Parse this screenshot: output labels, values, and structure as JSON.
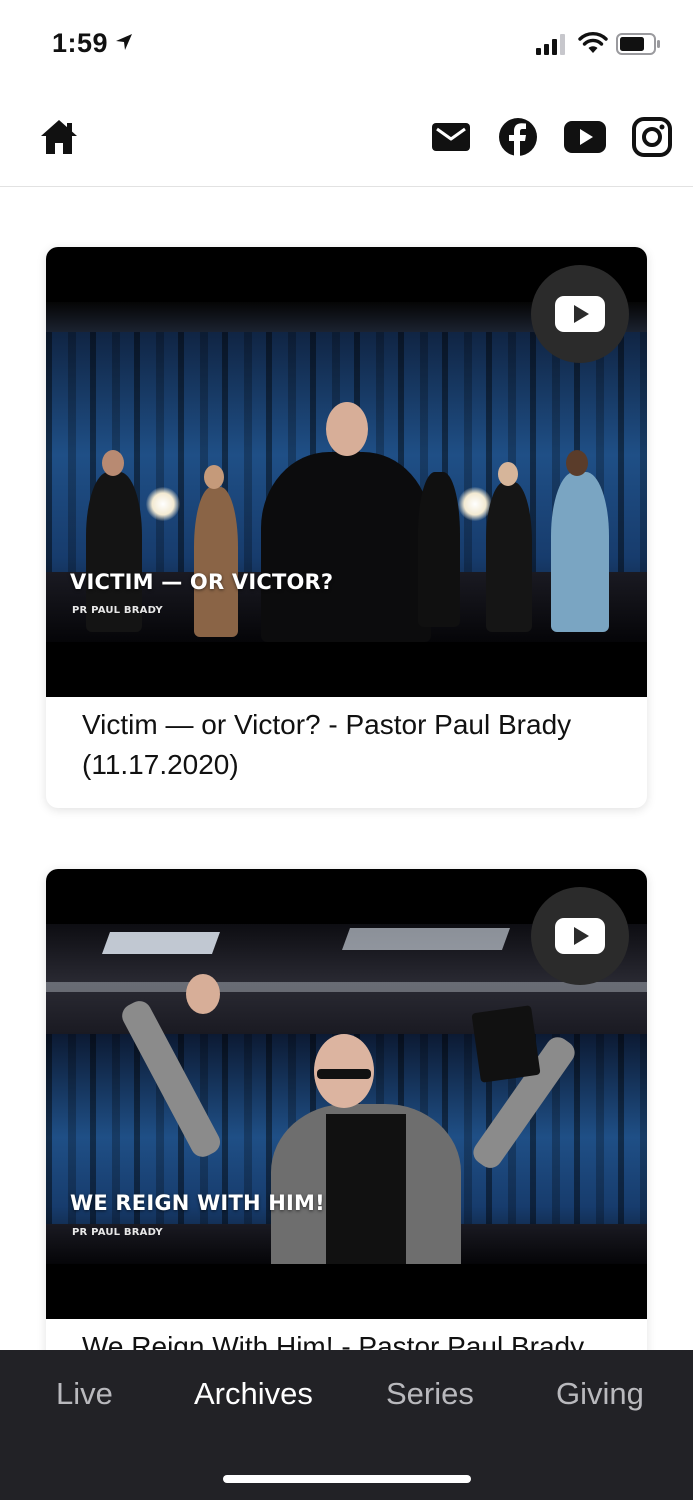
{
  "status_bar": {
    "time": "1:59",
    "icons": [
      "location-arrow-icon",
      "cellular-signal-icon",
      "wifi-icon",
      "battery-icon"
    ]
  },
  "header": {
    "icons": [
      "home-icon",
      "mail-icon",
      "facebook-icon",
      "youtube-icon",
      "instagram-icon"
    ]
  },
  "videos": [
    {
      "overlay_title": "VICTIM — OR VICTOR?",
      "overlay_subtitle": "PR PAUL BRADY",
      "title": "Victim — or Victor? - Pastor Paul Brady (11.17.2020)"
    },
    {
      "overlay_title": "WE REIGN WITH HIM!",
      "overlay_subtitle": "PR PAUL BRADY",
      "title": "We Reign With Him! - Pastor Paul Brady"
    }
  ],
  "tabs": [
    {
      "label": "Live",
      "active": false
    },
    {
      "label": "Archives",
      "active": true
    },
    {
      "label": "Series",
      "active": false
    },
    {
      "label": "Giving",
      "active": false
    }
  ],
  "colors": {
    "tabbar_bg": "#222226",
    "tab_active": "#ffffff",
    "tab_inactive": "#b9b9bd",
    "youtube_badge_bg": "#2b2b2b"
  }
}
